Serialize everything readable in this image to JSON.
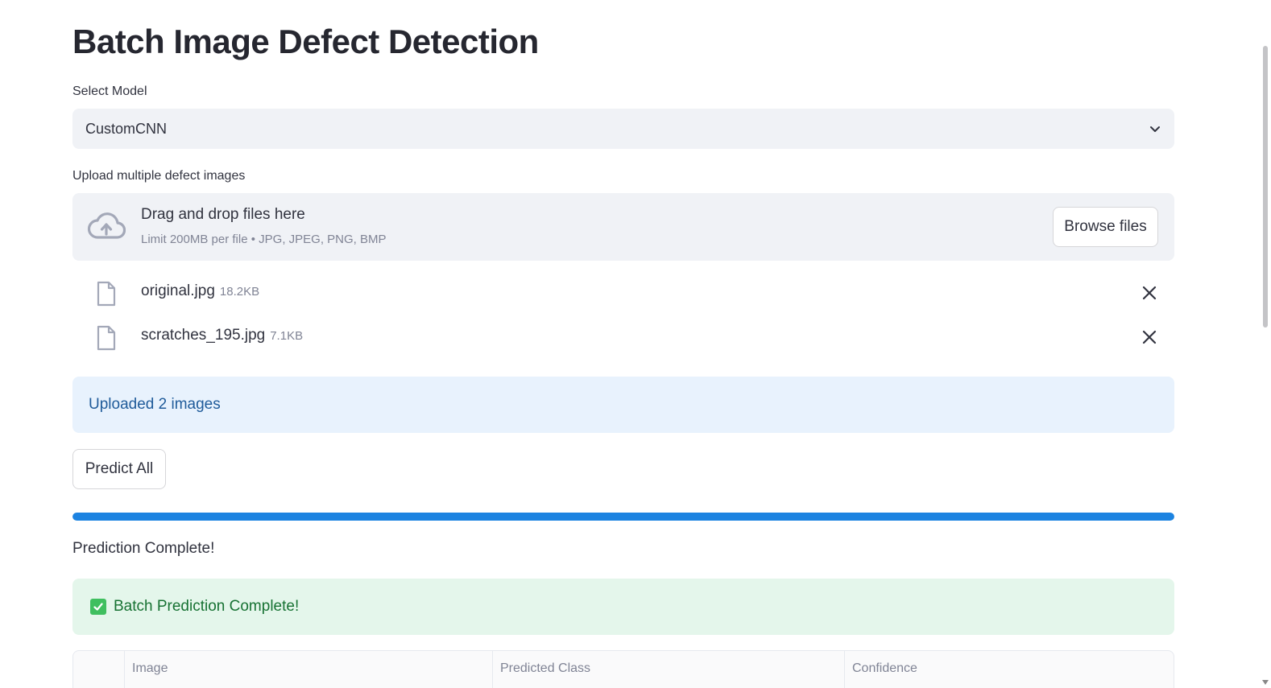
{
  "page": {
    "title": "Batch Image Defect Detection"
  },
  "model_select": {
    "label": "Select Model",
    "value": "CustomCNN"
  },
  "uploader": {
    "label": "Upload multiple defect images",
    "drop_text": "Drag and drop files here",
    "limit_text": "Limit 200MB per file • JPG, JPEG, PNG, BMP",
    "browse_label": "Browse files",
    "files": [
      {
        "name": "original.jpg",
        "size": "18.2KB"
      },
      {
        "name": "scratches_195.jpg",
        "size": "7.1KB"
      }
    ]
  },
  "info_message": "Uploaded 2 images",
  "predict_button": "Predict All",
  "progress": {
    "fraction": 1.0,
    "color": "#1c83e1"
  },
  "status_text": "Prediction Complete!",
  "success_message": "Batch Prediction Complete!",
  "results_table": {
    "columns": [
      "",
      "Image",
      "Predicted Class",
      "Confidence"
    ]
  },
  "colors": {
    "info_bg": "#e8f2fd",
    "success_bg": "#e4f6eb",
    "input_bg": "#f0f2f6"
  },
  "icons": {
    "upload": "cloud-upload-icon",
    "file": "file-icon",
    "remove": "close-icon",
    "dropdown": "chevron-down-icon",
    "check": "check-box-icon"
  }
}
